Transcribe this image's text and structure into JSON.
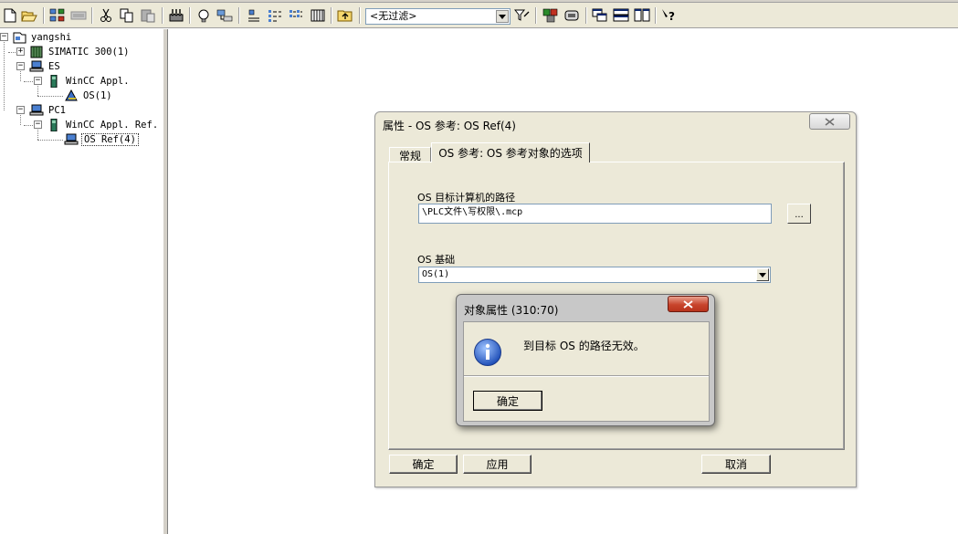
{
  "toolbar": {
    "buttons": [
      "new-file-icon",
      "open-folder-icon",
      "network-icon",
      "netpro-icon",
      "cut-icon",
      "copy-icon",
      "paste-icon",
      "download-icon",
      "online-icon",
      "accessible-nodes-icon",
      "large-icons-icon",
      "small-icons-icon",
      "list-icon",
      "details-icon",
      "up-one-level-icon",
      "filter-settings-icon",
      "simulation-icon",
      "memory-card-icon",
      "arrange-cascade-icon",
      "arrange-horizontal-icon",
      "arrange-vertical-icon",
      "help-icon"
    ],
    "filter_value": "<无过滤>"
  },
  "tree": {
    "nodes": [
      {
        "label": "yangshi",
        "icon": "project-icon"
      },
      {
        "label": "SIMATIC 300(1)",
        "icon": "simatic-station-icon"
      },
      {
        "label": "ES",
        "icon": "pc-station-icon"
      },
      {
        "label": "WinCC Appl.",
        "icon": "wincc-appl-icon"
      },
      {
        "label": "OS(1)",
        "icon": "os-icon"
      },
      {
        "label": "PC1",
        "icon": "pc-station-icon"
      },
      {
        "label": "WinCC Appl. Ref.",
        "icon": "wincc-appl-ref-icon"
      },
      {
        "label": "OS Ref(4)",
        "icon": "os-ref-icon"
      }
    ]
  },
  "properties_dialog": {
    "title": "属性 - OS 参考: OS Ref(4)",
    "tabs": [
      "常规",
      "OS 参考: OS 参考对象的选项"
    ],
    "active_tab": 1,
    "target_path_label": "OS 目标计算机的路径",
    "target_path_value": "\\PLC文件\\写权限\\.mcp",
    "browse_label": "...",
    "os_base_label": "OS 基础",
    "os_base_value": "OS(1)",
    "ok_label": "确定",
    "apply_label": "应用",
    "cancel_label": "取消"
  },
  "message_box": {
    "title": "对象属性 (310:70)",
    "icon": "info-icon",
    "text": "到目标 OS 的路径无效。",
    "ok_label": "确定"
  }
}
